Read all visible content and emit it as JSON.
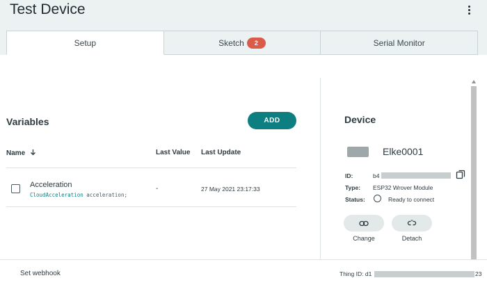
{
  "header": {
    "title": "Test Device",
    "menu_icon": "kebab-menu-icon"
  },
  "tabs": [
    {
      "label": "Setup",
      "active": true
    },
    {
      "label": "Sketch",
      "badge": "2"
    },
    {
      "label": "Serial Monitor"
    }
  ],
  "variables": {
    "title": "Variables",
    "add_label": "ADD",
    "columns": {
      "name": "Name",
      "last_value": "Last Value",
      "last_update": "Last Update"
    },
    "sort_icon": "arrow-down-icon",
    "rows": [
      {
        "name": "Acceleration",
        "type": "CloudAcceleration",
        "decl": "acceleration;",
        "last_value": "-",
        "last_update": "27 May 2021 23:17:33"
      }
    ]
  },
  "device": {
    "title": "Device",
    "name": "Elke0001",
    "id_label": "ID:",
    "id_value": "b4",
    "type_label": "Type:",
    "type_value": "ESP32 Wrover Module",
    "status_label": "Status:",
    "status_value": "Ready to connect",
    "change_label": "Change",
    "detach_label": "Detach"
  },
  "footer": {
    "webhook_label": "Set webhook",
    "thing_id_label": "Thing ID:",
    "thing_id_prefix": "d1",
    "thing_id_suffix": "23"
  },
  "colors": {
    "accent": "#0e7f81",
    "badge": "#da5b4a",
    "header_bg": "#ecf1f1"
  }
}
